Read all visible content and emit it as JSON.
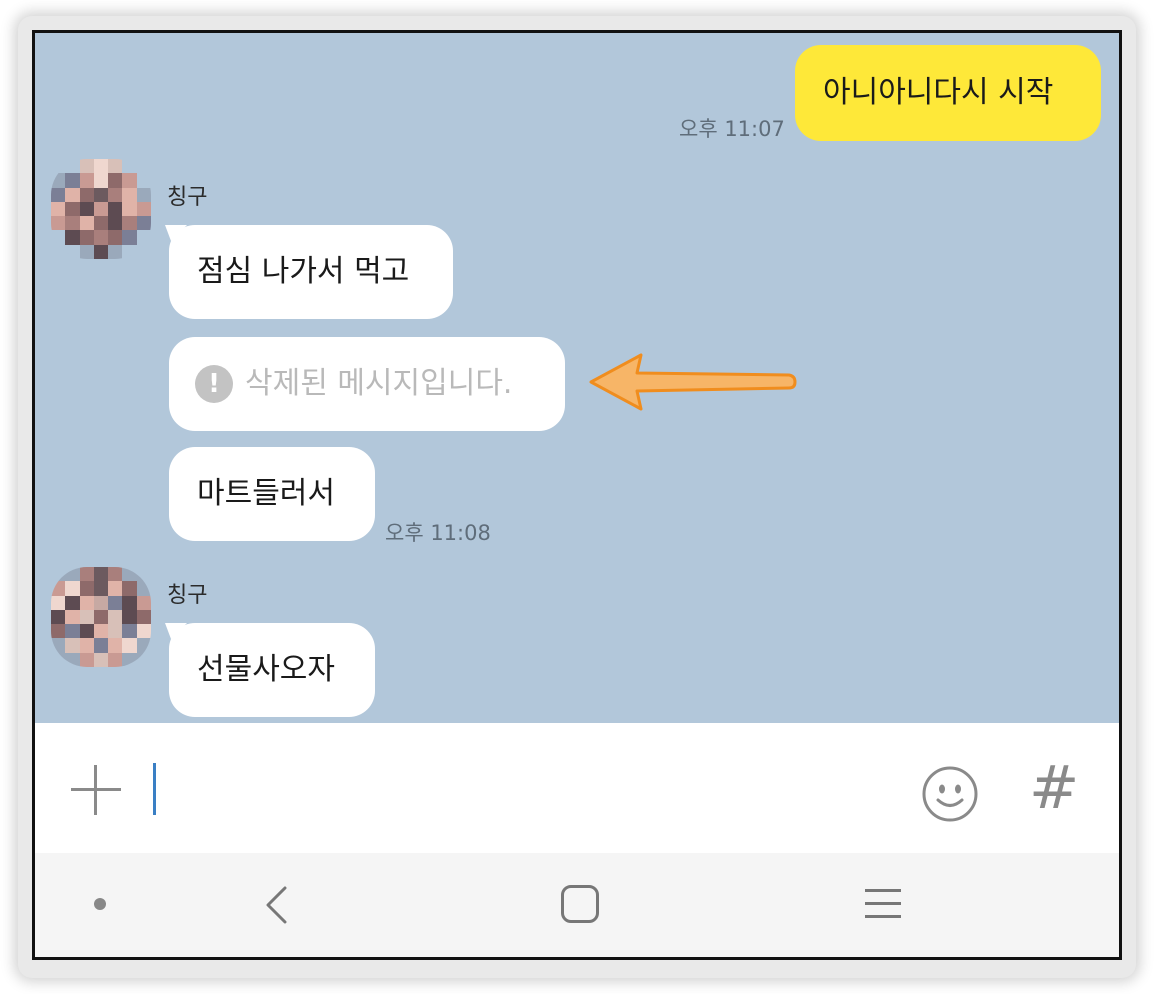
{
  "messages": {
    "mine_1": {
      "text": "아니아니다시 시작",
      "time": "오후 11:07"
    },
    "friend_1": {
      "sender": "칭구",
      "bubbles": [
        "점심 나가서 먹고",
        "삭제된 메시지입니다.",
        "마트들러서"
      ],
      "time": "오후 11:08"
    },
    "friend_2": {
      "sender": "칭구",
      "bubbles": [
        "선물사오자"
      ]
    }
  },
  "deleted_icon": "exclamation-circle-icon",
  "annotation_arrow_color": "#f6a23c",
  "chat_background": "#b2c7da",
  "my_bubble_color": "#fee839",
  "input": {
    "value": "",
    "left_icon": "plus-icon",
    "emoji_icon": "smiley-icon",
    "hash_label": "#"
  },
  "navigation": [
    "dot-icon",
    "back-icon",
    "home-icon",
    "recent-apps-icon"
  ]
}
